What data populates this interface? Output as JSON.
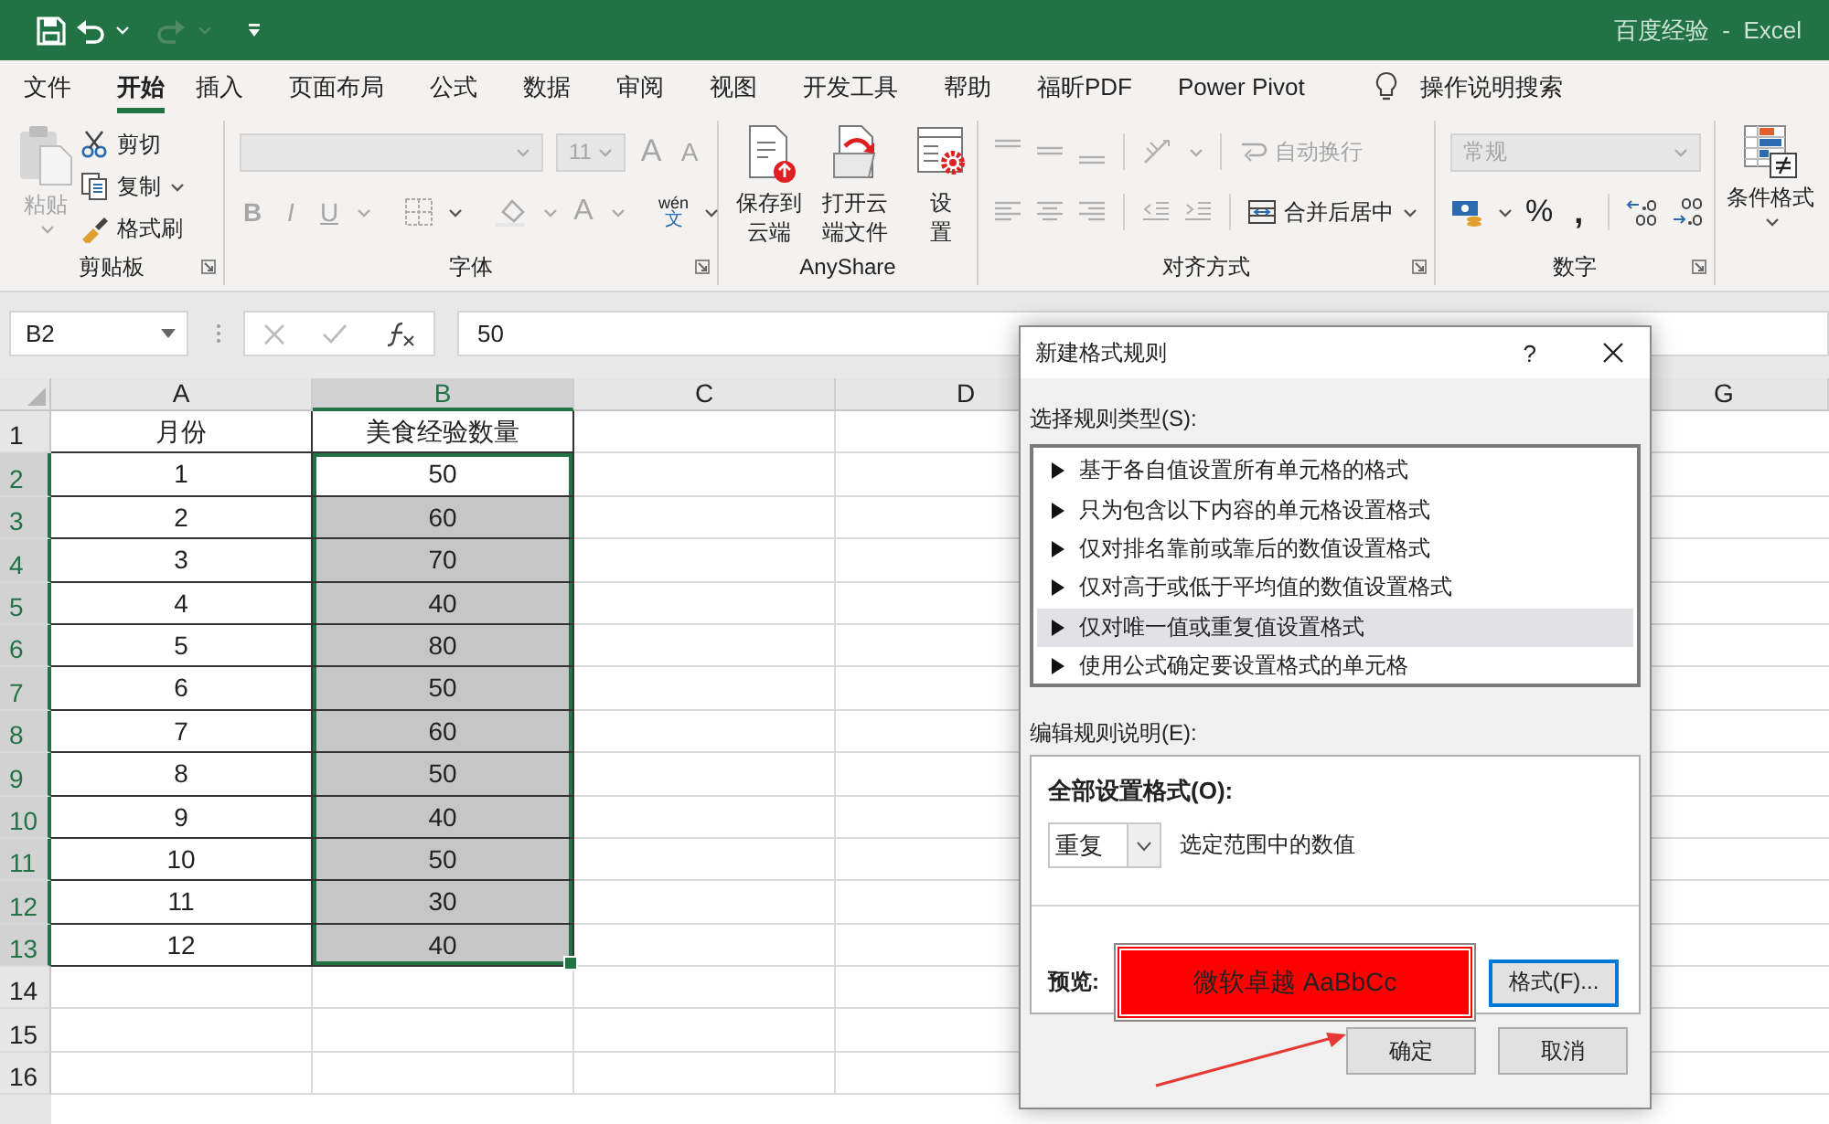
{
  "window": {
    "title": "百度经验  -  Excel"
  },
  "quick_access": {
    "undo_disabled": false,
    "redo_disabled": true
  },
  "ribbon_tabs": [
    {
      "label": "文件",
      "selected": false
    },
    {
      "label": "开始",
      "selected": true
    },
    {
      "label": "插入",
      "selected": false
    },
    {
      "label": "页面布局",
      "selected": false
    },
    {
      "label": "公式",
      "selected": false
    },
    {
      "label": "数据",
      "selected": false
    },
    {
      "label": "审阅",
      "selected": false
    },
    {
      "label": "视图",
      "selected": false
    },
    {
      "label": "开发工具",
      "selected": false
    },
    {
      "label": "帮助",
      "selected": false
    },
    {
      "label": "福昕PDF",
      "selected": false
    },
    {
      "label": "Power Pivot",
      "selected": false
    }
  ],
  "tell_me": "操作说明搜索",
  "clipboard": {
    "label": "剪贴板",
    "paste": {
      "label": "粘贴",
      "disabled": true
    },
    "actions": [
      {
        "kind": "cut",
        "label": "剪切",
        "dropdown": false
      },
      {
        "kind": "copy",
        "label": "复制",
        "dropdown": true
      },
      {
        "kind": "painter",
        "label": "格式刷",
        "dropdown": false
      }
    ]
  },
  "font": {
    "label": "字体",
    "disabled": true,
    "size": "11",
    "grow": "A",
    "shrink": "A",
    "styles": [
      "B",
      "I",
      "U"
    ],
    "color_letter": "A",
    "phonetic": {
      "pinyin": "wén",
      "char": "文"
    }
  },
  "anyshare": {
    "label": "AnyShare",
    "buttons": [
      {
        "kind": "upload",
        "label": "保存到云端"
      },
      {
        "kind": "open",
        "label": "打开云端文件"
      },
      {
        "kind": "settings",
        "label": "设置"
      }
    ]
  },
  "alignment": {
    "label": "对齐方式",
    "disabled": true,
    "wrap": {
      "label": "自动换行",
      "disabled": true
    },
    "merge": {
      "label": "合并后居中",
      "disabled": false
    }
  },
  "number": {
    "label": "数字",
    "format": "常规",
    "disabled": true,
    "percent": "%",
    "comma": ","
  },
  "styles": {
    "conditional": "条件格式"
  },
  "formula_bar": {
    "name_box": "B2",
    "value": "50"
  },
  "sheet": {
    "columns": [
      {
        "kind": "labeled",
        "label": "A",
        "selected": false
      },
      {
        "kind": "labeled",
        "label": "B",
        "selected": true
      },
      {
        "kind": "labeled",
        "label": "C",
        "selected": false
      },
      {
        "kind": "labeled",
        "label": "D",
        "selected": false
      },
      {
        "kind": "covered"
      },
      {
        "kind": "covered"
      },
      {
        "kind": "labeled",
        "label": "G",
        "selected": false
      }
    ],
    "rows": [
      {
        "header": "1",
        "selected": false,
        "cells": [
          {
            "text": "月份",
            "selected": false
          },
          {
            "text": "美食经验数量",
            "selected": false
          }
        ]
      },
      {
        "header": "2",
        "selected": true,
        "cells": [
          {
            "text": "1",
            "selected": false
          },
          {
            "text": "50",
            "selected": true,
            "active": true
          }
        ]
      },
      {
        "header": "3",
        "selected": true,
        "cells": [
          {
            "text": "2",
            "selected": false
          },
          {
            "text": "60",
            "selected": true,
            "active": false
          }
        ]
      },
      {
        "header": "4",
        "selected": true,
        "cells": [
          {
            "text": "3",
            "selected": false
          },
          {
            "text": "70",
            "selected": true,
            "active": false
          }
        ]
      },
      {
        "header": "5",
        "selected": true,
        "cells": [
          {
            "text": "4",
            "selected": false
          },
          {
            "text": "40",
            "selected": true,
            "active": false
          }
        ]
      },
      {
        "header": "6",
        "selected": true,
        "cells": [
          {
            "text": "5",
            "selected": false
          },
          {
            "text": "80",
            "selected": true,
            "active": false
          }
        ]
      },
      {
        "header": "7",
        "selected": true,
        "cells": [
          {
            "text": "6",
            "selected": false
          },
          {
            "text": "50",
            "selected": true,
            "active": false
          }
        ]
      },
      {
        "header": "8",
        "selected": true,
        "cells": [
          {
            "text": "7",
            "selected": false
          },
          {
            "text": "60",
            "selected": true,
            "active": false
          }
        ]
      },
      {
        "header": "9",
        "selected": true,
        "cells": [
          {
            "text": "8",
            "selected": false
          },
          {
            "text": "50",
            "selected": true,
            "active": false
          }
        ]
      },
      {
        "header": "10",
        "selected": true,
        "cells": [
          {
            "text": "9",
            "selected": false
          },
          {
            "text": "40",
            "selected": true,
            "active": false
          }
        ]
      },
      {
        "header": "11",
        "selected": true,
        "cells": [
          {
            "text": "10",
            "selected": false
          },
          {
            "text": "50",
            "selected": true,
            "active": false
          }
        ]
      },
      {
        "header": "12",
        "selected": true,
        "cells": [
          {
            "text": "11",
            "selected": false
          },
          {
            "text": "30",
            "selected": true,
            "active": false
          }
        ]
      },
      {
        "header": "13",
        "selected": true,
        "cells": [
          {
            "text": "12",
            "selected": false
          },
          {
            "text": "40",
            "selected": true,
            "active": false
          }
        ]
      },
      {
        "header": "14",
        "selected": false
      },
      {
        "header": "15",
        "selected": false
      },
      {
        "header": "16",
        "selected": false
      }
    ]
  },
  "dialog": {
    "title": "新建格式规则",
    "help": "?",
    "rule_type_label": "选择规则类型(S):",
    "rule_types": [
      {
        "label": "基于各自值设置所有单元格的格式",
        "selected": false
      },
      {
        "label": "只为包含以下内容的单元格设置格式",
        "selected": false
      },
      {
        "label": "仅对排名靠前或靠后的数值设置格式",
        "selected": false
      },
      {
        "label": "仅对高于或低于平均值的数值设置格式",
        "selected": false
      },
      {
        "label": "仅对唯一值或重复值设置格式",
        "selected": true
      },
      {
        "label": "使用公式确定要设置格式的单元格",
        "selected": false
      }
    ],
    "edit_label": "编辑规则说明(E):",
    "format_all_label": "全部设置格式(O):",
    "mode": "重复",
    "mode_suffix": "选定范围中的数值",
    "preview_label": "预览:",
    "preview_text": "微软卓越  AaBbCc",
    "format_button": {
      "label": "格式(F)...",
      "focused": true
    },
    "buttons": [
      {
        "label": "确定"
      },
      {
        "label": "取消"
      }
    ]
  }
}
